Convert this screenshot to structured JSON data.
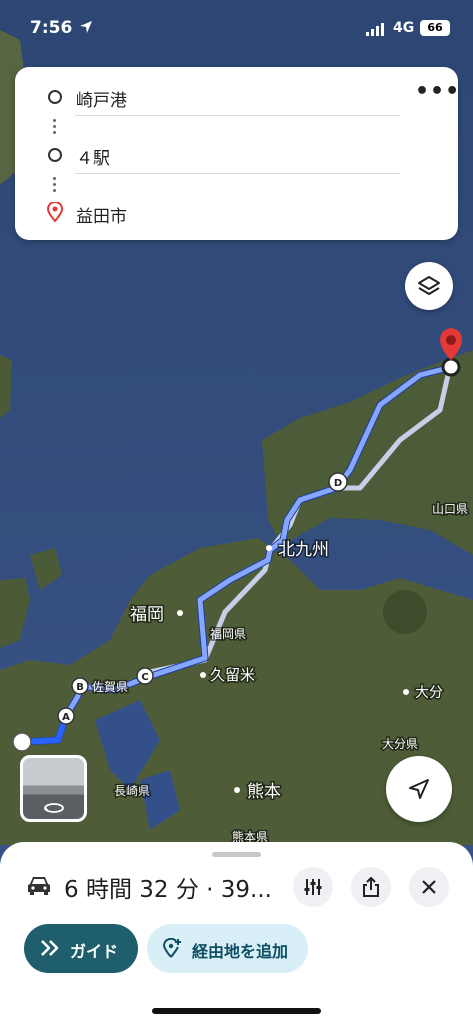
{
  "status": {
    "time": "7:56",
    "network": "4G",
    "battery": "66"
  },
  "route": {
    "stops": [
      {
        "label": "崎戸港",
        "icon": "circle-icon"
      },
      {
        "label": "４駅",
        "icon": "circle-icon"
      },
      {
        "label": "益田市",
        "icon": "pin-icon"
      }
    ],
    "more_icon": "more-horizontal-icon"
  },
  "map": {
    "labels": {
      "kitakyushu": "北九州",
      "fukuoka": "福岡",
      "fukuoka_pref": "福岡県",
      "kurume": "久留米",
      "saga_pref": "佐賀県",
      "nagasaki_pref": "長崎県",
      "kumamoto": "熊本",
      "kumamoto_pref": "熊本県",
      "oita": "大分",
      "oita_pref": "大分県",
      "yamaguchi_pref": "山口県"
    },
    "waypoints": [
      "A",
      "B",
      "C",
      "D"
    ],
    "route_color": "#4a73ff"
  },
  "sheet": {
    "summary": "6 時間 32 分 · 39...",
    "guide_label": "ガイド",
    "add_stop_label": "経由地を追加"
  },
  "colors": {
    "guide_bg": "#1f5e6d",
    "add_stop_bg": "#d8eff7",
    "pin": "#e53935"
  }
}
